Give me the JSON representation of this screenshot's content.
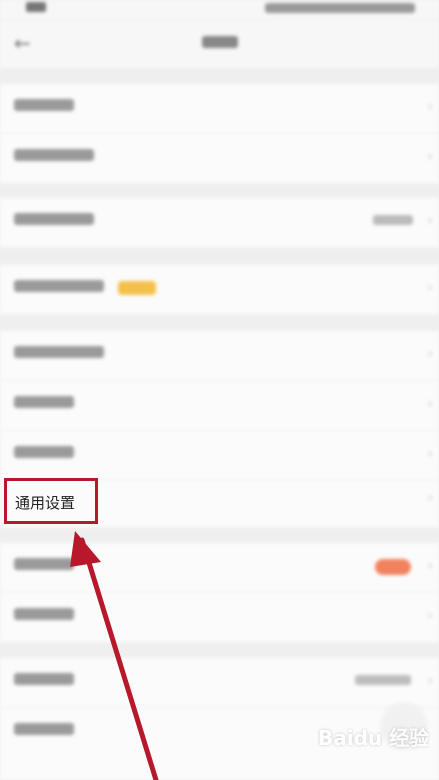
{
  "general_settings_label": "通用设置",
  "watermark_text": "Baidu 经验",
  "colors": {
    "highlight_border": "#b8182b",
    "arrow": "#b8182b",
    "tag_yellow": "#f3c14a",
    "badge_red": "#f1825f"
  },
  "icons": {
    "back": "back-arrow-icon",
    "chevron": "chevron-right-icon"
  }
}
